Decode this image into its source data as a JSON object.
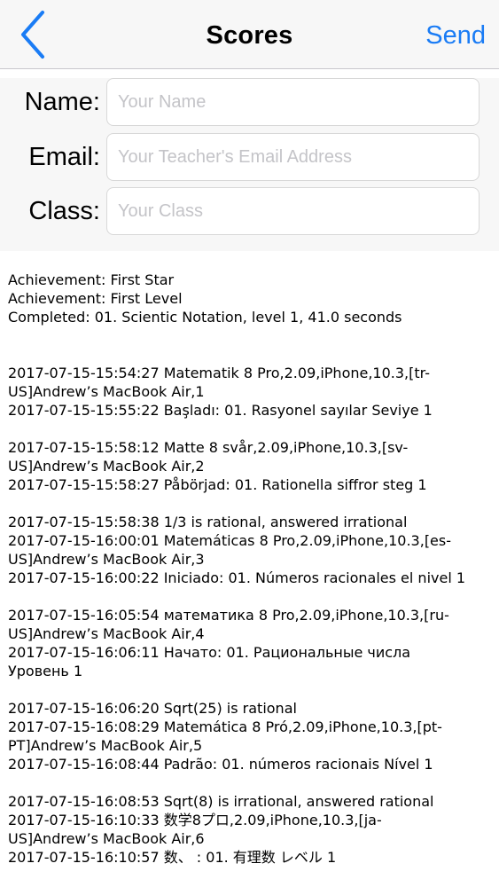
{
  "navbar": {
    "back_icon": "chevron-left-icon",
    "title": "Scores",
    "send_label": "Send",
    "accent_color": "#1a7cf5"
  },
  "form": {
    "name_label": "Name:",
    "name_placeholder": "Your Name",
    "email_label": "Email:",
    "email_placeholder": "Your Teacher's Email Address",
    "class_label": "Class:",
    "class_placeholder": "Your Class"
  },
  "log": {
    "summary": [
      "Achievement: First Star",
      "Achievement: First Level",
      "Completed: 01. Scientic Notation, level 1, 41.0 seconds"
    ],
    "blocks": [
      [
        "2017-07-15-15:54:27 Matematik 8 Pro,2.09,iPhone,10.3,[tr-",
        "US]Andrew’s MacBook Air,1",
        "2017-07-15-15:55:22 Başladı: 01. Rasyonel sayılar  Seviye 1"
      ],
      [
        "2017-07-15-15:58:12 Matte 8 svår,2.09,iPhone,10.3,[sv-",
        "US]Andrew’s MacBook Air,2",
        "2017-07-15-15:58:27 Påbörjad: 01. Rationella siffror  steg 1"
      ],
      [
        "2017-07-15-15:58:38 1/3 is  rational, answered irrational",
        "2017-07-15-16:00:01 Matemáticas 8 Pro,2.09,iPhone,10.3,[es-",
        "US]Andrew’s MacBook Air,3",
        "2017-07-15-16:00:22 Iniciado: 01. Números racionales el nivel 1"
      ],
      [
        "2017-07-15-16:05:54 математика 8 Pro,2.09,iPhone,10.3,[ru-",
        "US]Andrew’s MacBook Air,4",
        "2017-07-15-16:06:11 Начато: 01. Рациональные числа",
        "Уровень 1"
      ],
      [
        "2017-07-15-16:06:20 Sqrt(25) is  rational",
        "2017-07-15-16:08:29 Matemática 8 Pró,2.09,iPhone,10.3,[pt-",
        "PT]Andrew’s MacBook Air,5",
        "2017-07-15-16:08:44 Padrão: 01. números racionais  Nível 1"
      ],
      [
        "2017-07-15-16:08:53 Sqrt(8) is  irrational, answered rational",
        "2017-07-15-16:10:33 数学8プロ,2.09,iPhone,10.3,[ja-",
        "US]Andrew’s MacBook Air,6",
        "2017-07-15-16:10:57 数、 : 01. 有理数  レベル 1"
      ]
    ]
  }
}
